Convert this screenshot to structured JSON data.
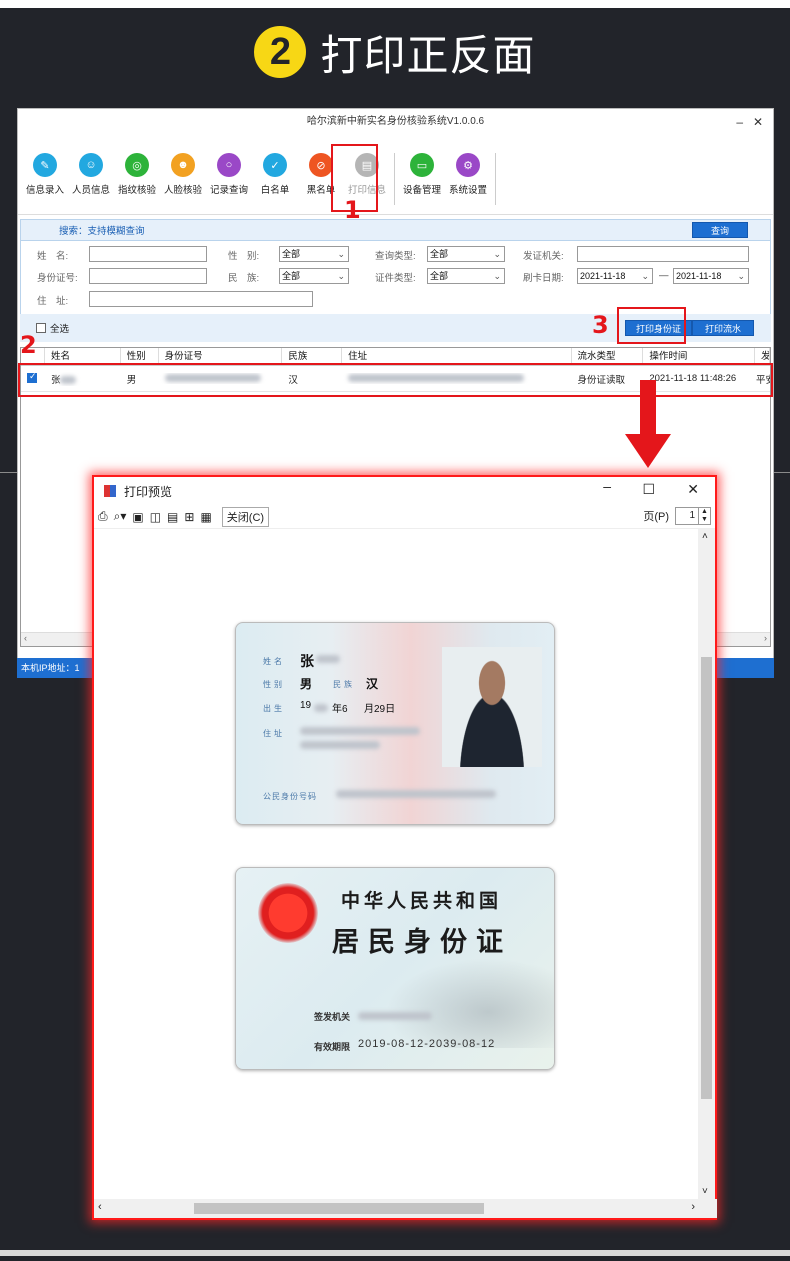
{
  "heading": {
    "step": "2",
    "title": "打印正反面"
  },
  "app": {
    "title": "哈尔滨新中新实名身份核验系统V1.0.0.6",
    "minimize": "–",
    "close": "✕",
    "toolbar": [
      {
        "label": "信息录入",
        "icon": "edit-icon",
        "color": "#22a8e0"
      },
      {
        "label": "人员信息",
        "icon": "people-icon",
        "color": "#22a8e0"
      },
      {
        "label": "指纹核验",
        "icon": "fingerprint-icon",
        "color": "#2db33a"
      },
      {
        "label": "人脸核验",
        "icon": "face-icon",
        "color": "#f2a121"
      },
      {
        "label": "记录查询",
        "icon": "search-icon",
        "color": "#9a48c7"
      },
      {
        "label": "白名单",
        "icon": "check-icon",
        "color": "#22a8e0"
      },
      {
        "label": "黑名单",
        "icon": "forbidden-icon",
        "color": "#ee5522"
      },
      {
        "label": "打印信息",
        "icon": "printer-icon",
        "color": "#b5b5b5"
      },
      {
        "label": "设备管理",
        "icon": "monitor-icon",
        "color": "#2db33a"
      },
      {
        "label": "系统设置",
        "icon": "gear-icon",
        "color": "#9a48c7"
      }
    ],
    "search": {
      "label": "搜索：支持模糊查询",
      "button": "查询"
    },
    "form": {
      "name_label": "姓　名:",
      "gender_label": "性　别:",
      "gender_value": "全部",
      "query_type_label": "查询类型:",
      "query_type_value": "全部",
      "issuer_label": "发证机关:",
      "id_label": "身份证号:",
      "ethnic_label": "民　族:",
      "ethnic_value": "全部",
      "cert_type_label": "证件类型:",
      "cert_type_value": "全部",
      "date_label": "刷卡日期:",
      "date_from": "2021-11-18",
      "date_sep": "—",
      "date_to": "2021-11-18",
      "address_label": "住　址:"
    },
    "select_all": "全选",
    "print_id_button": "打印身份证",
    "print_flow_button": "打印流水",
    "table": {
      "headers": [
        "姓名",
        "性别",
        "身份证号",
        "民族",
        "住址",
        "流水类型",
        "操作时间",
        "发"
      ],
      "row": {
        "name": "张",
        "gender": "男",
        "ethnic": "汉",
        "flow_type": "身份证读取",
        "time": "2021-11-18 11:48:26",
        "extra": "平安"
      }
    },
    "status_bar": "本机IP地址：1"
  },
  "annotations": {
    "box1": "1",
    "box2": "2",
    "box3": "3"
  },
  "preview": {
    "title": "打印预览",
    "close_button": "关闭(C)",
    "page_label": "页(P)",
    "page_value": "1",
    "front": {
      "name_label": "姓名",
      "name_value": "张",
      "gender_label": "性别",
      "gender_value": "男",
      "ethnic_label": "民族",
      "ethnic_value": "汉",
      "birth_label": "出生",
      "birth_year": "19",
      "birth_month_unit": "年6",
      "birth_day_unit": "月29日",
      "address_label": "住址",
      "id_label": "公民身份号码"
    },
    "back": {
      "country": "中华人民共和国",
      "card_title": "居民身份证",
      "issuer_label": "签发机关",
      "validity_label": "有效期限",
      "validity_value": "2019-08-12-2039-08-12"
    }
  }
}
